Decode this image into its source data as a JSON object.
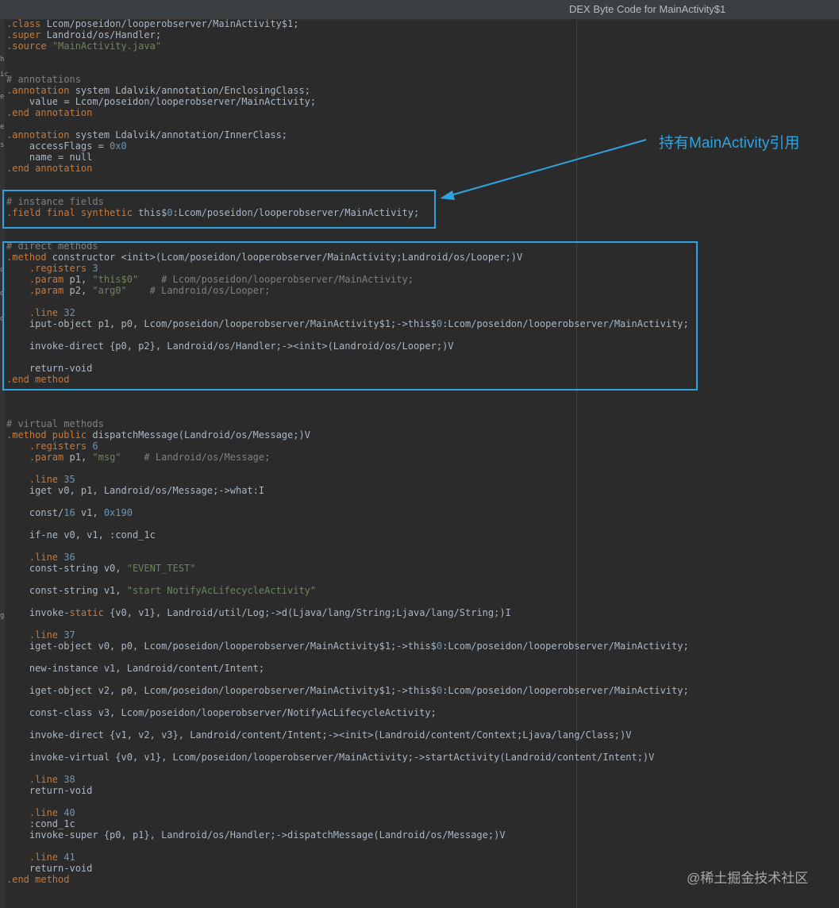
{
  "window": {
    "title": "DEX Byte Code for MainActivity$1"
  },
  "annotation": {
    "text": "持有MainActivity引用"
  },
  "watermark": {
    "text": "@稀土掘金技术社区"
  },
  "colors": {
    "background": "#2b2b2b",
    "keyword": "#cc7832",
    "string": "#6a8759",
    "number": "#6897bb",
    "comment": "#808080",
    "plain": "#a9b7c6",
    "highlight": "#2fa3e0"
  },
  "gutter_glyphs": [
    "h",
    "ic",
    "e",
    "e",
    "s",
    "o",
    "o",
    "o",
    "g"
  ],
  "code": [
    [
      [
        ".class",
        "kw"
      ],
      [
        " Lcom/poseidon/looperobserver/MainActivity$1;",
        "p"
      ]
    ],
    [
      [
        ".super",
        "kw"
      ],
      [
        " Landroid/os/Handler;",
        "p"
      ]
    ],
    [
      [
        ".source",
        "kw"
      ],
      [
        " ",
        "p"
      ],
      [
        "\"MainActivity.java\"",
        "str"
      ]
    ],
    [],
    [],
    [
      [
        "# annotations",
        "cmt"
      ]
    ],
    [
      [
        ".annotation",
        "kw"
      ],
      [
        " system Ldalvik/annotation/EnclosingClass;",
        "p"
      ]
    ],
    [
      [
        "    value = Lcom/poseidon/looperobserver/MainActivity;",
        "p"
      ]
    ],
    [
      [
        ".end annotation",
        "kw"
      ]
    ],
    [],
    [
      [
        ".annotation",
        "kw"
      ],
      [
        " system Ldalvik/annotation/InnerClass;",
        "p"
      ]
    ],
    [
      [
        "    accessFlags = ",
        "p"
      ],
      [
        "0x0",
        "num"
      ]
    ],
    [
      [
        "    name = null",
        "p"
      ]
    ],
    [
      [
        ".end annotation",
        "kw"
      ]
    ],
    [],
    [],
    [
      [
        "# instance fields",
        "cmt"
      ]
    ],
    [
      [
        ".field final synthetic",
        "kw"
      ],
      [
        " this$",
        "p"
      ],
      [
        "0",
        "num"
      ],
      [
        ":Lcom/poseidon/looperobserver/MainActivity;",
        "p"
      ]
    ],
    [],
    [],
    [
      [
        "# direct methods",
        "cmt"
      ]
    ],
    [
      [
        ".method",
        "kw"
      ],
      [
        " constructor <init>(Lcom/poseidon/looperobserver/MainActivity;Landroid/os/Looper;)V",
        "p"
      ]
    ],
    [
      [
        "    ",
        "p"
      ],
      [
        ".registers",
        "kw"
      ],
      [
        " ",
        "p"
      ],
      [
        "3",
        "num"
      ]
    ],
    [
      [
        "    ",
        "p"
      ],
      [
        ".param",
        "kw"
      ],
      [
        " p1, ",
        "p"
      ],
      [
        "\"this$0\"",
        "str"
      ],
      [
        "    # Lcom/poseidon/looperobserver/MainActivity;",
        "cmt"
      ]
    ],
    [
      [
        "    ",
        "p"
      ],
      [
        ".param",
        "kw"
      ],
      [
        " p2, ",
        "p"
      ],
      [
        "\"arg0\"",
        "str"
      ],
      [
        "    # Landroid/os/Looper;",
        "cmt"
      ]
    ],
    [],
    [
      [
        "    ",
        "p"
      ],
      [
        ".line",
        "kw"
      ],
      [
        " ",
        "p"
      ],
      [
        "32",
        "num"
      ]
    ],
    [
      [
        "    iput-object p1, p0, Lcom/poseidon/looperobserver/MainActivity$1;->this$",
        "p"
      ],
      [
        "0",
        "num"
      ],
      [
        ":Lcom/poseidon/looperobserver/MainActivity;",
        "p"
      ]
    ],
    [],
    [
      [
        "    invoke-direct {p0, p2}, Landroid/os/Handler;-><init>(Landroid/os/Looper;)V",
        "p"
      ]
    ],
    [],
    [
      [
        "    return-void",
        "p"
      ]
    ],
    [
      [
        ".end method",
        "kw"
      ]
    ],
    [],
    [],
    [],
    [
      [
        "# virtual methods",
        "cmt"
      ]
    ],
    [
      [
        ".method public",
        "kw"
      ],
      [
        " dispatchMessage(Landroid/os/Message;)V",
        "p"
      ]
    ],
    [
      [
        "    ",
        "p"
      ],
      [
        ".registers",
        "kw"
      ],
      [
        " ",
        "p"
      ],
      [
        "6",
        "num"
      ]
    ],
    [
      [
        "    ",
        "p"
      ],
      [
        ".param",
        "kw"
      ],
      [
        " p1, ",
        "p"
      ],
      [
        "\"msg\"",
        "str"
      ],
      [
        "    # Landroid/os/Message;",
        "cmt"
      ]
    ],
    [],
    [
      [
        "    ",
        "p"
      ],
      [
        ".line",
        "kw"
      ],
      [
        " ",
        "p"
      ],
      [
        "35",
        "num"
      ]
    ],
    [
      [
        "    iget v0, p1, Landroid/os/Message;->what:I",
        "p"
      ]
    ],
    [],
    [
      [
        "    const/",
        "p"
      ],
      [
        "16",
        "num"
      ],
      [
        " v1, ",
        "p"
      ],
      [
        "0x190",
        "num"
      ]
    ],
    [],
    [
      [
        "    if-ne v0, v1, :cond_1c",
        "p"
      ]
    ],
    [],
    [
      [
        "    ",
        "p"
      ],
      [
        ".line",
        "kw"
      ],
      [
        " ",
        "p"
      ],
      [
        "36",
        "num"
      ]
    ],
    [
      [
        "    const-string v0, ",
        "p"
      ],
      [
        "\"EVENT_TEST\"",
        "str"
      ]
    ],
    [],
    [
      [
        "    const-string v1, ",
        "p"
      ],
      [
        "\"start NotifyAcLifecycleActivity\"",
        "str"
      ]
    ],
    [],
    [
      [
        "    invoke-",
        "p"
      ],
      [
        "static",
        "kw"
      ],
      [
        " {v0, v1}, Landroid/util/Log;->d(Ljava/lang/String;Ljava/lang/String;)I",
        "p"
      ]
    ],
    [],
    [
      [
        "    ",
        "p"
      ],
      [
        ".line",
        "kw"
      ],
      [
        " ",
        "p"
      ],
      [
        "37",
        "num"
      ]
    ],
    [
      [
        "    iget-object v0, p0, Lcom/poseidon/looperobserver/MainActivity$1;->this$",
        "p"
      ],
      [
        "0",
        "num"
      ],
      [
        ":Lcom/poseidon/looperobserver/MainActivity;",
        "p"
      ]
    ],
    [],
    [
      [
        "    new-instance v1, Landroid/content/Intent;",
        "p"
      ]
    ],
    [],
    [
      [
        "    iget-object v2, p0, Lcom/poseidon/looperobserver/MainActivity$1;->this$",
        "p"
      ],
      [
        "0",
        "num"
      ],
      [
        ":Lcom/poseidon/looperobserver/MainActivity;",
        "p"
      ]
    ],
    [],
    [
      [
        "    const-class v3, Lcom/poseidon/looperobserver/NotifyAcLifecycleActivity;",
        "p"
      ]
    ],
    [],
    [
      [
        "    invoke-direct {v1, v2, v3}, Landroid/content/Intent;-><init>(Landroid/content/Context;Ljava/lang/Class;)V",
        "p"
      ]
    ],
    [],
    [
      [
        "    invoke-virtual {v0, v1}, Lcom/poseidon/looperobserver/MainActivity;->startActivity(Landroid/content/Intent;)V",
        "p"
      ]
    ],
    [],
    [
      [
        "    ",
        "p"
      ],
      [
        ".line",
        "kw"
      ],
      [
        " ",
        "p"
      ],
      [
        "38",
        "num"
      ]
    ],
    [
      [
        "    return-void",
        "p"
      ]
    ],
    [],
    [
      [
        "    ",
        "p"
      ],
      [
        ".line",
        "kw"
      ],
      [
        " ",
        "p"
      ],
      [
        "40",
        "num"
      ]
    ],
    [
      [
        "    :cond_1c",
        "p"
      ]
    ],
    [
      [
        "    invoke-super {p0, p1}, Landroid/os/Handler;->dispatchMessage(Landroid/os/Message;)V",
        "p"
      ]
    ],
    [],
    [
      [
        "    ",
        "p"
      ],
      [
        ".line",
        "kw"
      ],
      [
        " ",
        "p"
      ],
      [
        "41",
        "num"
      ]
    ],
    [
      [
        "    return-void",
        "p"
      ]
    ],
    [
      [
        ".end method",
        "kw"
      ]
    ]
  ]
}
